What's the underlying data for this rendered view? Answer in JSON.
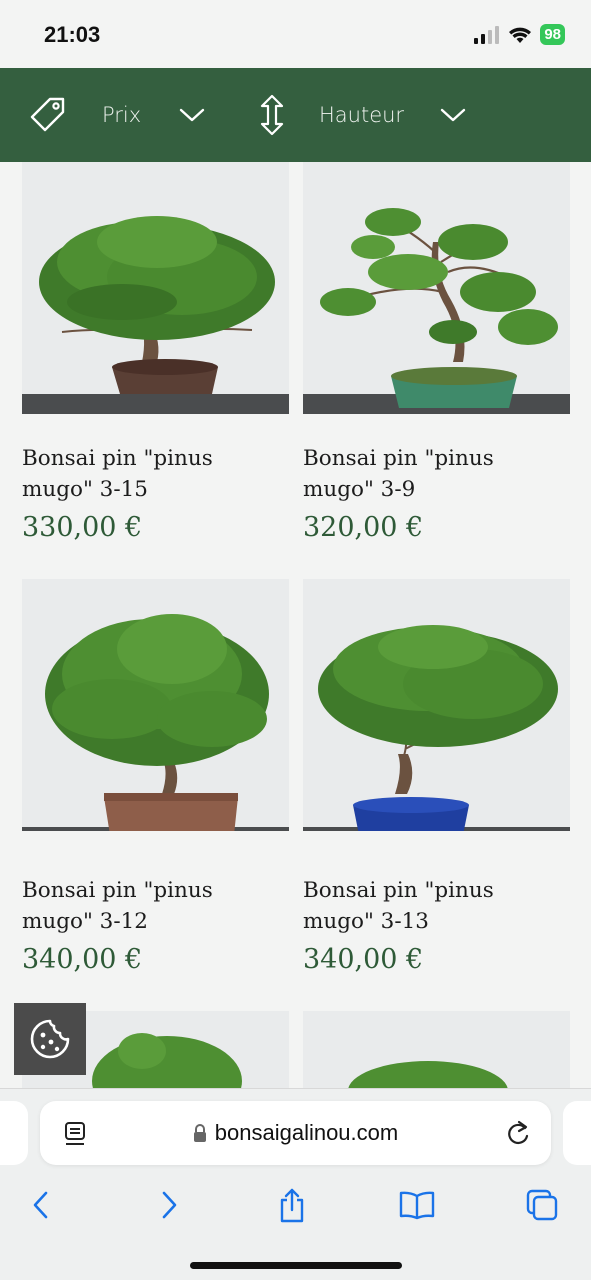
{
  "status_bar": {
    "time": "21:03",
    "battery": "98"
  },
  "filters": [
    {
      "label": "Prix",
      "icon": "price-tag-icon"
    },
    {
      "label": "Hauteur",
      "icon": "vertical-arrows-icon"
    }
  ],
  "products": [
    {
      "name_line1": "Bonsai pin \"pinus",
      "name_line2": "mugo\" 3-15",
      "price": "330,00 €",
      "pot_color": "#5a3f35"
    },
    {
      "name_line1": "Bonsai pin \"pinus",
      "name_line2": "mugo\" 3-9",
      "price": "320,00 €",
      "pot_color": "#3f8a6a"
    },
    {
      "name_line1": "Bonsai pin \"pinus",
      "name_line2": "mugo\" 3-12",
      "price": "340,00 €",
      "pot_color": "#8e5e4a"
    },
    {
      "name_line1": "Bonsai pin \"pinus",
      "name_line2": "mugo\" 3-13",
      "price": "340,00 €",
      "pot_color": "#1f3fa0"
    }
  ],
  "browser": {
    "url": "bonsaigalinou.com"
  },
  "colors": {
    "brand_green": "#345f3f",
    "price_green": "#2e5a37",
    "ios_blue": "#1a73e8"
  }
}
